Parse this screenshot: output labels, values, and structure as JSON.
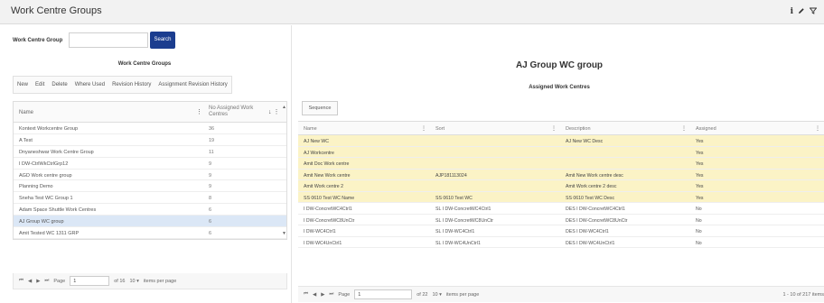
{
  "window": {
    "title": "Work Centre Groups",
    "icons": [
      "info-icon",
      "pencil-icon",
      "filter-icon"
    ]
  },
  "search": {
    "label": "Work Centre Group",
    "value": "",
    "button": "Search"
  },
  "left": {
    "heading": "Work Centre Groups",
    "toolbar": [
      "New",
      "Edit",
      "Delete",
      "Where Used",
      "Revision History",
      "Assignment Revision History"
    ],
    "columns": [
      "Name",
      "No Assigned Work Centres"
    ],
    "rows": [
      {
        "name": "Kontext Workcentre Group",
        "count": "36"
      },
      {
        "name": "A Test",
        "count": "19"
      },
      {
        "name": "Dnyaneshwar Work Centre Group",
        "count": "11"
      },
      {
        "name": "I DW-CtrlWkCtrlGrp12",
        "count": "9"
      },
      {
        "name": "AGD Work centre group",
        "count": "9"
      },
      {
        "name": "Planning Demo",
        "count": "9"
      },
      {
        "name": "Sneha Test WC Group 1",
        "count": "8"
      },
      {
        "name": "Adam Space Shuttle Work Centres",
        "count": "6"
      },
      {
        "name": "AJ Group WC group",
        "count": "6",
        "selected": true
      },
      {
        "name": "Amit Tested WC 1311 GRP",
        "count": "6"
      }
    ],
    "pager": {
      "page_label": "Page",
      "page": "1",
      "of": "of 16",
      "size": "10",
      "items_label": "items per page"
    }
  },
  "right": {
    "title": "AJ Group WC group",
    "subtitle": "Assigned Work Centres",
    "sequence_button": "Sequence",
    "columns": [
      "Name",
      "Sort",
      "Description",
      "Assigned"
    ],
    "rows": [
      {
        "name": "AJ New WC",
        "sort": "",
        "desc": "AJ New WC Desc",
        "assigned": "Yes",
        "hl": true
      },
      {
        "name": "AJ Workcentre",
        "sort": "",
        "desc": "",
        "assigned": "Yes",
        "hl": true
      },
      {
        "name": "Amit Doc Work centre",
        "sort": "",
        "desc": "",
        "assigned": "Yes",
        "hl": true
      },
      {
        "name": "Amit New Work centre",
        "sort": "AJP181113024",
        "desc": "Amit New Work centre desc",
        "assigned": "Yes",
        "hl": true
      },
      {
        "name": "Amit Work centre 2",
        "sort": "",
        "desc": "Amit Work centre 2 desc",
        "assigned": "Yes",
        "hl": true
      },
      {
        "name": "SS 0610 Test WC Name",
        "sort": "SS 0610 Test WC",
        "desc": "SS 0610 Test WC Desc",
        "assigned": "Yes",
        "hl": true
      },
      {
        "name": "I DW-ConcretWC4Ctrl1",
        "sort": "SL I DW-ConcretWC4Ctrl1",
        "desc": "DES I DW-ConcretWC4Ctrl1",
        "assigned": "No",
        "hl": false
      },
      {
        "name": "I DW-ConcretWC8UnCtr",
        "sort": "SL I DW-ConcretWC8UnCtr",
        "desc": "DES I DW-ConcretWC8UnCtr",
        "assigned": "No",
        "hl": false
      },
      {
        "name": "I DW-WC4Ctrl1",
        "sort": "SL I DW-WC4Ctrl1",
        "desc": "DES I DW-WC4Ctrl1",
        "assigned": "No",
        "hl": false
      },
      {
        "name": "I DW-WC4UnCtrl1",
        "sort": "SL I DW-WC4UnCtrl1",
        "desc": "DES I DW-WC4UnCtrl1",
        "assigned": "No",
        "hl": false
      }
    ],
    "pager": {
      "page_label": "Page",
      "page": "1",
      "of": "of 22",
      "size": "10",
      "items_label": "items per page",
      "count": "1 - 10 of 217 items"
    }
  }
}
